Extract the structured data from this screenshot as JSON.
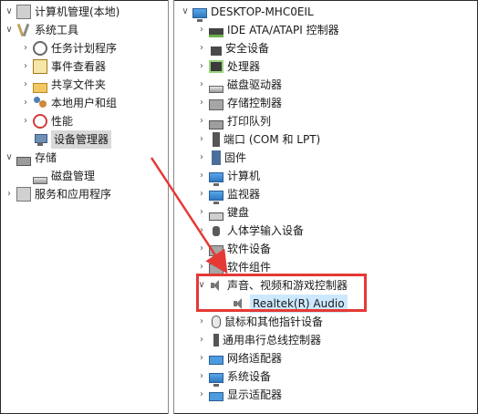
{
  "left_tree": {
    "root_label": "计算机管理(本地)",
    "system_tools_label": "系统工具",
    "task_scheduler_label": "任务计划程序",
    "event_viewer_label": "事件查看器",
    "shared_folders_label": "共享文件夹",
    "local_users_label": "本地用户和组",
    "performance_label": "性能",
    "device_manager_label": "设备管理器",
    "storage_label": "存储",
    "disk_management_label": "磁盘管理",
    "services_apps_label": "服务和应用程序"
  },
  "device_tree": {
    "computer_name": "DESKTOP-MHC0EIL",
    "categories": [
      {
        "label": "IDE ATA/ATAPI 控制器",
        "icon": "ide-controller-icon"
      },
      {
        "label": "安全设备",
        "icon": "security-device-icon"
      },
      {
        "label": "处理器",
        "icon": "processor-icon"
      },
      {
        "label": "磁盘驱动器",
        "icon": "disk-drive-icon"
      },
      {
        "label": "存储控制器",
        "icon": "storage-controller-icon"
      },
      {
        "label": "打印队列",
        "icon": "printer-icon"
      },
      {
        "label": "端口 (COM 和 LPT)",
        "icon": "port-icon"
      },
      {
        "label": "固件",
        "icon": "firmware-icon"
      },
      {
        "label": "计算机",
        "icon": "computer-icon"
      },
      {
        "label": "监视器",
        "icon": "monitor-icon"
      },
      {
        "label": "键盘",
        "icon": "keyboard-icon"
      },
      {
        "label": "人体学输入设备",
        "icon": "hid-icon"
      },
      {
        "label": "软件设备",
        "icon": "software-device-icon"
      },
      {
        "label": "软件组件",
        "icon": "software-component-icon"
      },
      {
        "label": "声音、视频和游戏控制器",
        "icon": "speaker-icon"
      },
      {
        "label": "鼠标和其他指针设备",
        "icon": "mouse-icon"
      },
      {
        "label": "通用串行总线控制器",
        "icon": "usb-icon"
      },
      {
        "label": "网络适配器",
        "icon": "network-adapter-icon"
      },
      {
        "label": "系统设备",
        "icon": "system-device-icon"
      },
      {
        "label": "显示适配器",
        "icon": "display-adapter-icon"
      }
    ],
    "audio_child_label": "Realtek(R) Audio"
  },
  "colors": {
    "highlight_box": "#e53935",
    "arrow": "#e53935",
    "selection": "#cce8ff"
  }
}
